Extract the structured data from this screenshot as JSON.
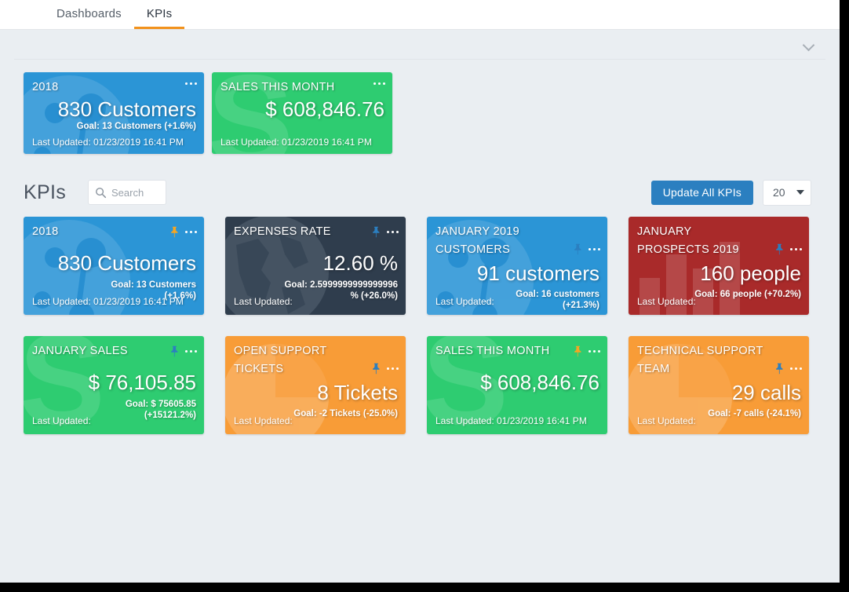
{
  "header": {
    "tabs": [
      {
        "label": "Dashboards",
        "active": false
      },
      {
        "label": "KPIs",
        "active": true
      }
    ]
  },
  "pinned_section": {
    "collapse_icon": "chevron-down-icon",
    "cards": [
      {
        "title": "2018",
        "value": "830 Customers",
        "goal": "Goal: 13 Customers (+1.6%)",
        "updated": "Last Updated: 01/23/2019 16:41 PM",
        "color": "#2b95d6",
        "watermark": "network-icon",
        "pinned": true
      },
      {
        "title": "SALES THIS MONTH",
        "value": "$ 608,846.76",
        "goal": "",
        "updated": "Last Updated: 01/23/2019 16:41 PM",
        "color": "#2ecc71",
        "watermark": "dollar-s-icon",
        "pinned": true
      }
    ]
  },
  "toolbar": {
    "title": "KPIs",
    "search_placeholder": "Search",
    "search_value": "",
    "search_icon": "search-icon",
    "update_all_label": "Update All KPIs",
    "page_size_value": "20",
    "page_size_icon": "chevron-down-icon",
    "accent_blue": "#2b7fc0"
  },
  "kpi_cards": [
    {
      "title": "2018",
      "value": "830 Customers",
      "goal": "Goal: 13 Customers (+1.6%)",
      "updated": "Last Updated: 01/23/2019 16:41 PM",
      "color": "#2b95d6",
      "watermark": "network-icon",
      "pin_state": "pinned",
      "pin_color": "#f5a623"
    },
    {
      "title": "EXPENSES RATE",
      "value": "12.60 %",
      "goal": "Goal: 2.5999999999999996 % (+26.0%)",
      "updated": "Last Updated:",
      "color": "#2f3d4d",
      "watermark": "globe-icon",
      "pin_state": "unpinned",
      "pin_color": "#2b7fc0"
    },
    {
      "title": "JANUARY 2019 CUSTOMERS",
      "value": "91 customers",
      "goal": "Goal: 16 customers (+21.3%)",
      "updated": "Last Updated:",
      "color": "#2b95d6",
      "watermark": "network-icon",
      "pin_state": "unpinned",
      "pin_color": "#2b7fc0"
    },
    {
      "title": "JANUARY PROSPECTS 2019",
      "value": "160 people",
      "goal": "Goal: 66 people (+70.2%)",
      "updated": "Last Updated:",
      "color": "#a92a2a",
      "watermark": "bar-chart-icon",
      "pin_state": "unpinned",
      "pin_color": "#2b7fc0"
    },
    {
      "title": "JANUARY SALES",
      "value": "$ 76,105.85",
      "goal": "Goal: $ 75605.85 (+15121.2%)",
      "updated": "Last Updated:",
      "color": "#2ecc71",
      "watermark": "dollar-s-icon",
      "pin_state": "unpinned",
      "pin_color": "#2b7fc0"
    },
    {
      "title": "OPEN SUPPORT TICKETS",
      "value": "8 Tickets",
      "goal": "Goal: -2 Tickets (-25.0%)",
      "updated": "Last Updated:",
      "color": "#f89c37",
      "watermark": "pie-chart-icon",
      "pin_state": "unpinned",
      "pin_color": "#2b7fc0"
    },
    {
      "title": "SALES THIS MONTH",
      "value": "$ 608,846.76",
      "goal": "",
      "updated": "Last Updated: 01/23/2019 16:41 PM",
      "color": "#2ecc71",
      "watermark": "dollar-s-icon",
      "pin_state": "pinned",
      "pin_color": "#f5a623"
    },
    {
      "title": "TECHNICAL SUPPORT TEAM",
      "value": "29 calls",
      "goal": "Goal: -7 calls (-24.1%)",
      "updated": "Last Updated:",
      "color": "#f89c37",
      "watermark": "pie-chart-icon",
      "pin_state": "unpinned",
      "pin_color": "#2b7fc0"
    }
  ]
}
